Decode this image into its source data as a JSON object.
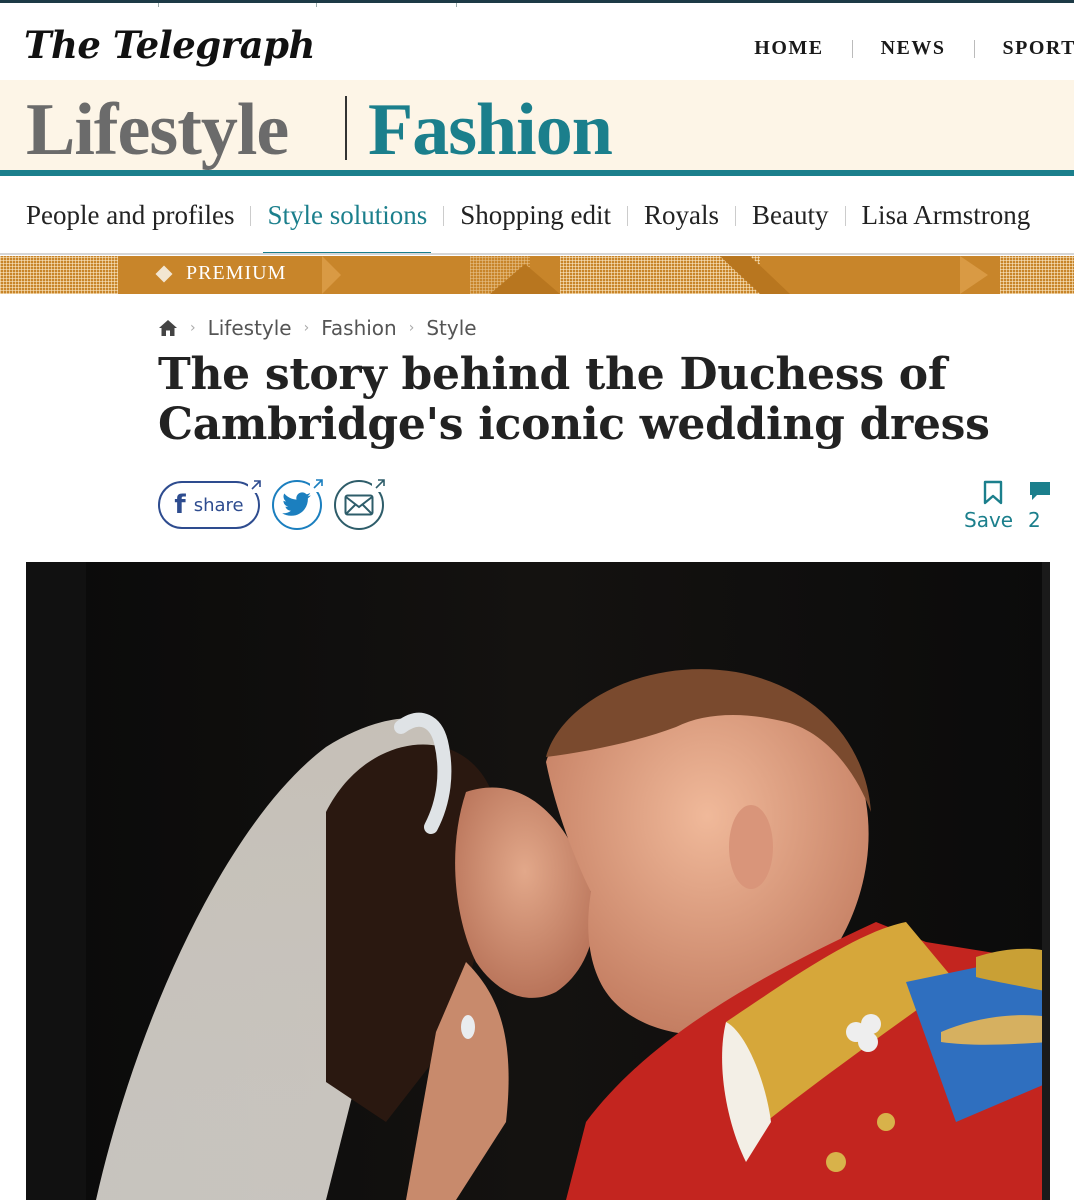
{
  "masthead": {
    "logo": "The Telegraph",
    "nav": [
      "HOME",
      "NEWS",
      "SPORT"
    ]
  },
  "section": {
    "parent": "Lifestyle",
    "name": "Fashion",
    "accent": "#1b7f8c"
  },
  "subnav": {
    "items": [
      "People and profiles",
      "Style solutions",
      "Shopping edit",
      "Royals",
      "Beauty",
      "Lisa Armstrong"
    ],
    "active": "Style solutions"
  },
  "premium": {
    "label": "PREMIUM",
    "color": "#c8852a"
  },
  "breadcrumb": {
    "items": [
      "Lifestyle",
      "Fashion",
      "Style"
    ]
  },
  "article": {
    "headline": "The story behind the Duchess of Cambridge's iconic wedding dress"
  },
  "share": {
    "facebook_label": "share"
  },
  "tools": {
    "save_label": "Save",
    "comment_count": "2"
  },
  "icons": [
    "home-icon",
    "facebook-icon",
    "twitter-icon",
    "email-icon",
    "external-link-icon",
    "bookmark-icon",
    "comment-icon"
  ]
}
